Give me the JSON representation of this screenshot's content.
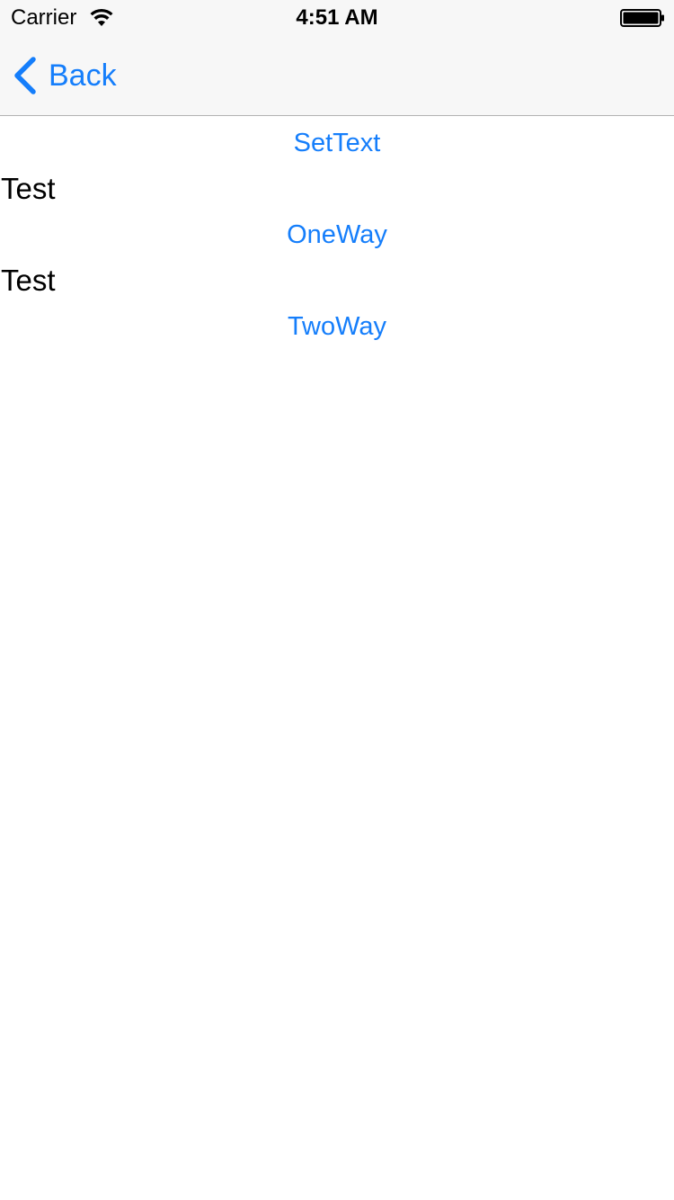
{
  "status_bar": {
    "carrier": "Carrier",
    "time": "4:51 AM",
    "wifi_icon": "wifi-icon",
    "battery_icon": "battery-icon"
  },
  "nav": {
    "back_icon": "chevron-left-icon",
    "back_label": "Back"
  },
  "content": {
    "settext_button": "SetText",
    "label_1": "Test",
    "oneway_button": "OneWay",
    "label_2": "Test",
    "twoway_button": "TwoWay"
  },
  "colors": {
    "tint": "#157efb",
    "nav_background": "#f7f7f7",
    "text": "#000000",
    "background": "#ffffff"
  }
}
